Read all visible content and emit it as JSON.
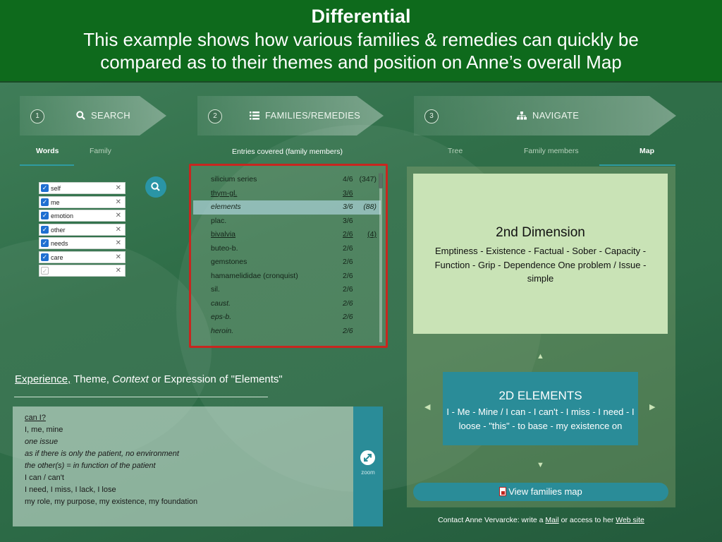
{
  "banner": {
    "title": "Differential",
    "subtitle": "This example shows how various families & remedies can quickly be compared as to their themes and position on Anne’s overall Map"
  },
  "steps": [
    {
      "num": "1",
      "label": "SEARCH",
      "icon": "search-icon"
    },
    {
      "num": "2",
      "label": "FAMILIES/REMEDIES",
      "icon": "list-icon"
    },
    {
      "num": "3",
      "label": "NAVIGATE",
      "icon": "sitemap-icon"
    }
  ],
  "search": {
    "tabs": [
      "Words",
      "Family"
    ],
    "active_tab": "Words",
    "words": [
      "self",
      "me",
      "emotion",
      "other",
      "needs",
      "care",
      ""
    ]
  },
  "families": {
    "header": "Entries covered (family members)",
    "rows": [
      {
        "name": "silicium series",
        "frac": "4/6",
        "count": "(347)",
        "style": ""
      },
      {
        "name": "thym-gl.",
        "frac": "3/6",
        "count": "",
        "style": "u"
      },
      {
        "name": "elements",
        "frac": "3/6",
        "count": "(88)",
        "style": "i",
        "selected": true
      },
      {
        "name": "plac.",
        "frac": "3/6",
        "count": "",
        "style": ""
      },
      {
        "name": "bivalvia",
        "frac": "2/6",
        "count": "(4)",
        "style": "u"
      },
      {
        "name": "buteo-b.",
        "frac": "2/6",
        "count": "",
        "style": ""
      },
      {
        "name": "gemstones",
        "frac": "2/6",
        "count": "",
        "style": ""
      },
      {
        "name": "hamamelididae (cronquist)",
        "frac": "2/6",
        "count": "",
        "style": ""
      },
      {
        "name": "sil.",
        "frac": "2/6",
        "count": "",
        "style": ""
      },
      {
        "name": "caust.",
        "frac": "2/6",
        "count": "",
        "style": "i"
      },
      {
        "name": "eps-b.",
        "frac": "2/6",
        "count": "",
        "style": "i"
      },
      {
        "name": "heroin.",
        "frac": "2/6",
        "count": "",
        "style": "i"
      }
    ]
  },
  "navigate": {
    "tabs": [
      "Tree",
      "Family members",
      "Map"
    ],
    "active_tab": "Map",
    "dimension": {
      "title": "2nd Dimension",
      "desc": "Emptiness - Existence - Factual - Sober - Capacity - Function - Grip - Dependence One problem / Issue - simple"
    },
    "elements": {
      "title": "2D ELEMENTS",
      "desc": "I - Me - Mine / I can - I can't - I miss - I need - I loose - \"this\" - to base - my existence on"
    },
    "view_map_label": "View families map",
    "contact": {
      "prefix": "Contact Anne Vervarcke: write a",
      "mail": "Mail",
      "middle": "or access to her",
      "web": "Web site"
    }
  },
  "experience": {
    "heading_experience": "Experience,",
    "heading_theme": "Theme,",
    "heading_context": "Context",
    "heading_rest": "or Expression of \"Elements\"",
    "lines": [
      {
        "text": "can I?",
        "style": "u"
      },
      {
        "text": "I, me, mine",
        "style": ""
      },
      {
        "text": "one issue",
        "style": "i"
      },
      {
        "text": "as if there is only the patient, no environment",
        "style": "i"
      },
      {
        "text": "the other(s) = in function of the patient",
        "style": "i"
      },
      {
        "text": "I can / can't",
        "style": ""
      },
      {
        "text": "I need, I miss, I lack, I lose",
        "style": ""
      },
      {
        "text": "my role, my purpose, my existence, my foundation",
        "style": ""
      }
    ],
    "zoom_label": "zoom"
  },
  "colors": {
    "banner": "#0e6a1c",
    "accent": "#2a8c98",
    "highlight_border": "#c8261f",
    "dimension_box": "#c9e3b6"
  }
}
